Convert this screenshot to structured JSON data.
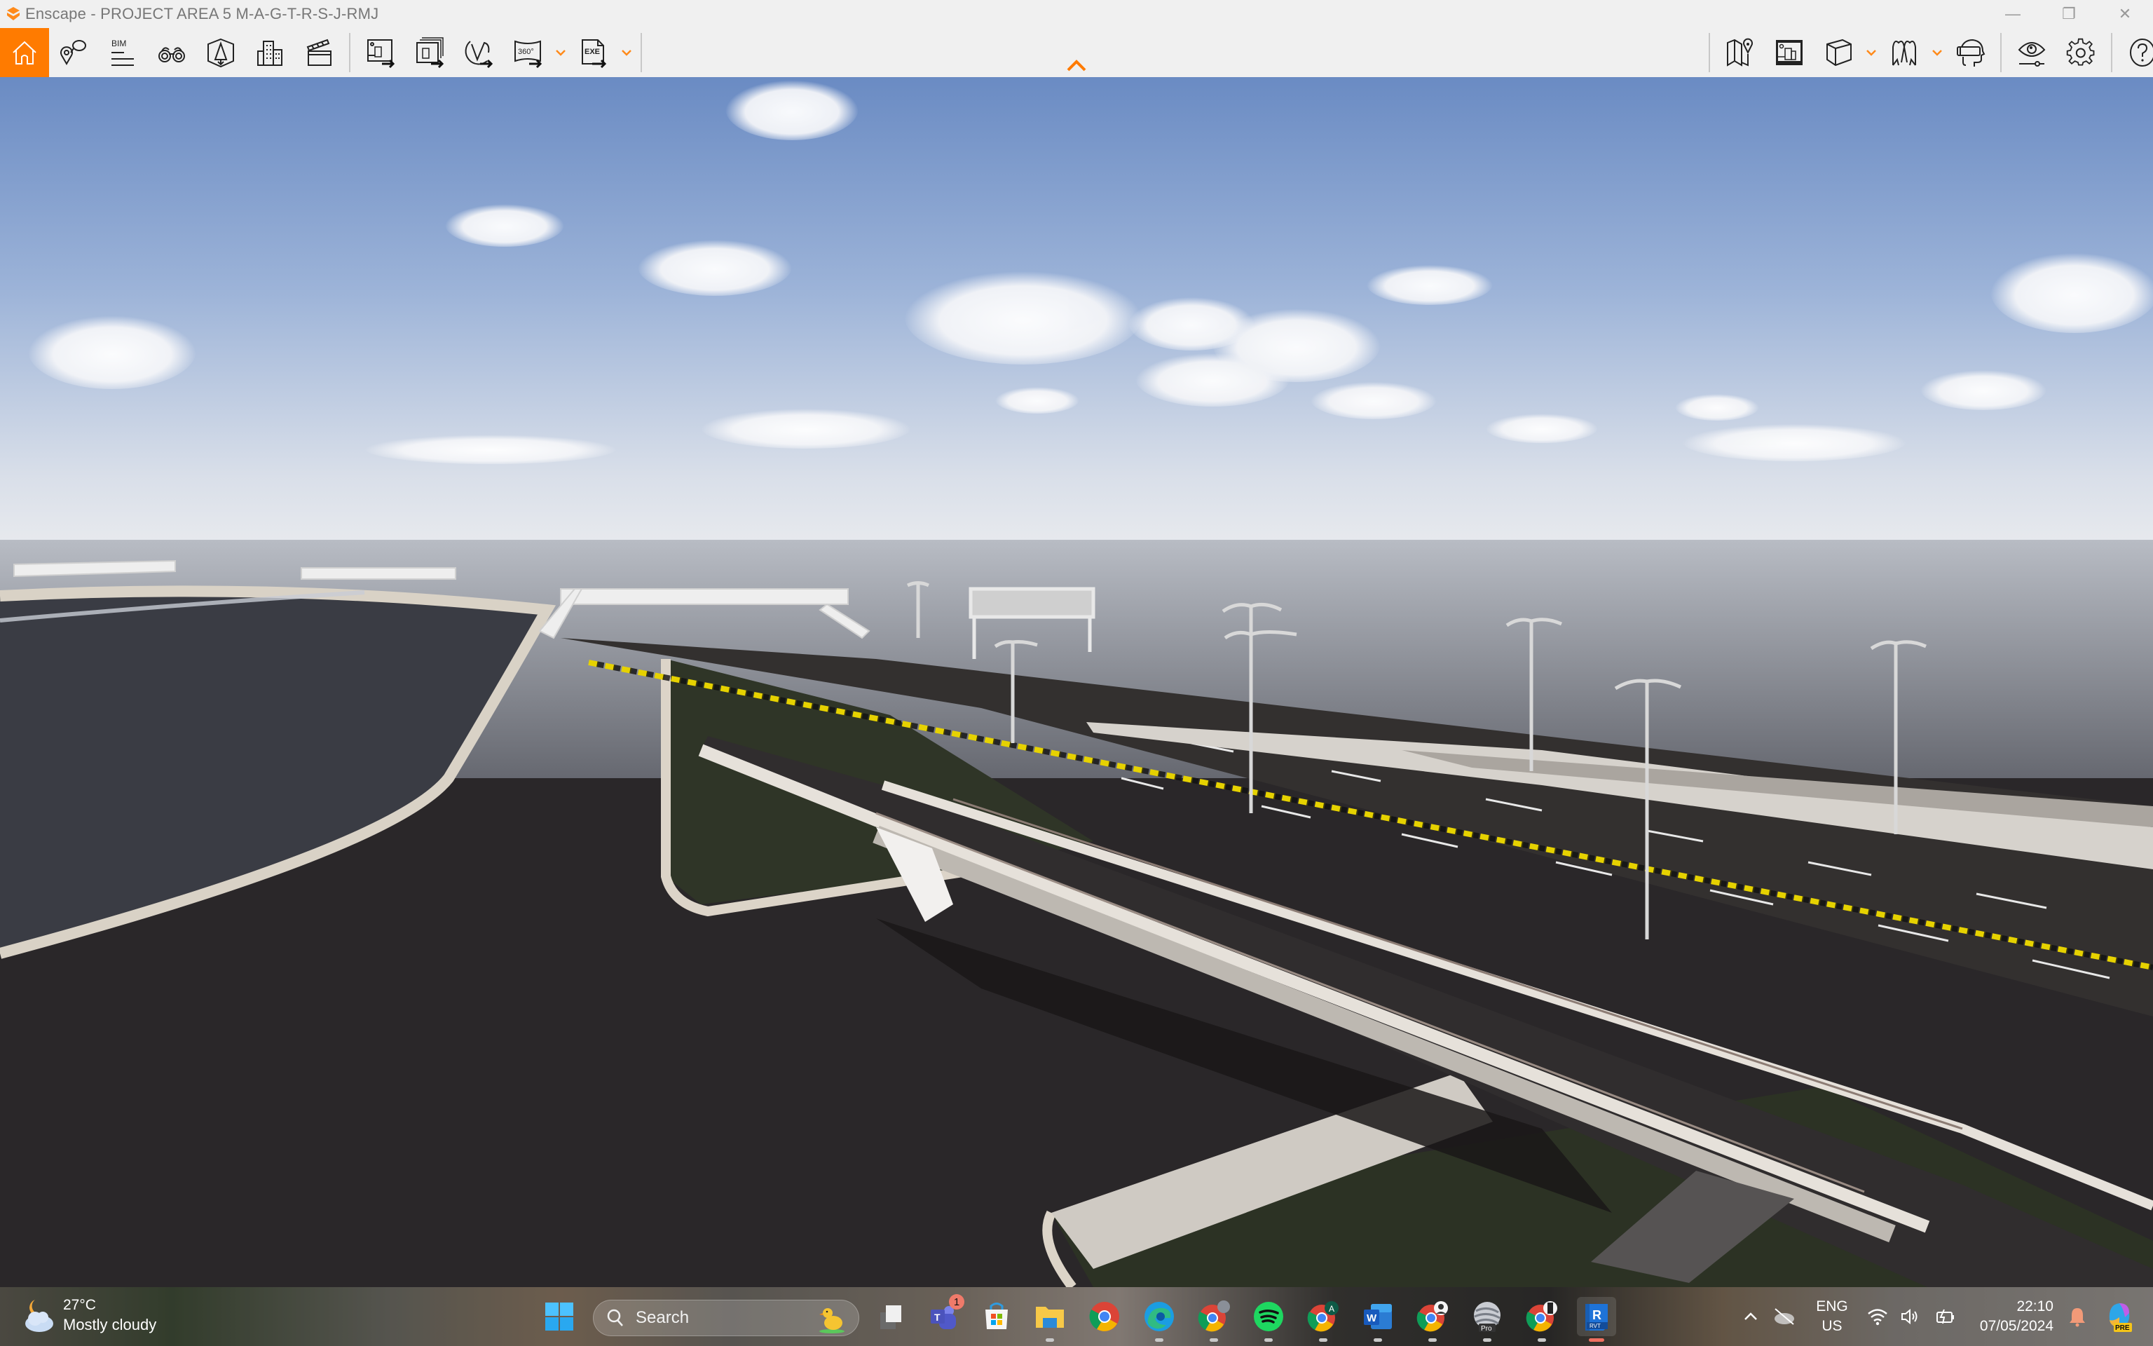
{
  "window": {
    "title": "Enscape - PROJECT AREA 5 M-A-G-T-R-S-J-RMJ",
    "accent_color": "#ff7b00",
    "controls": {
      "minimize": "—",
      "restore": "❐",
      "close": "✕"
    }
  },
  "toolbar": {
    "left_group": [
      {
        "id": "home",
        "icon": "home-icon",
        "active": true
      },
      {
        "id": "views",
        "icon": "map-pin-comment-icon"
      },
      {
        "id": "bim",
        "icon": "bim-info-icon",
        "label": "BIM"
      },
      {
        "id": "orbit",
        "icon": "binoculars-icon"
      },
      {
        "id": "assets",
        "icon": "asset-library-icon"
      },
      {
        "id": "sites",
        "icon": "buildings-icon"
      },
      {
        "id": "video",
        "icon": "clapperboard-icon"
      }
    ],
    "export_group": [
      {
        "id": "screenshot",
        "icon": "export-screenshot-icon"
      },
      {
        "id": "batch",
        "icon": "batch-render-icon"
      },
      {
        "id": "web",
        "icon": "web-standalone-icon"
      },
      {
        "id": "pano",
        "icon": "panorama-360-icon",
        "label": "360°",
        "has_dropdown": true
      },
      {
        "id": "exe",
        "icon": "export-exe-icon",
        "label": "EXE",
        "has_dropdown": true
      }
    ],
    "right_group": [
      {
        "id": "map",
        "icon": "map-location-icon"
      },
      {
        "id": "gallery",
        "icon": "gallery-icon"
      },
      {
        "id": "cube",
        "icon": "view-cube-icon",
        "has_dropdown": true
      },
      {
        "id": "vr",
        "icon": "vr-mode-icon",
        "has_dropdown": true
      },
      {
        "id": "headset",
        "icon": "vr-headset-icon"
      }
    ],
    "settings_group": [
      {
        "id": "visual",
        "icon": "visual-settings-icon"
      },
      {
        "id": "settings",
        "icon": "gear-icon"
      },
      {
        "id": "help",
        "icon": "help-icon"
      }
    ],
    "collapse_icon": "chevron-up-icon"
  },
  "scene": {
    "description": "3D rendered highway interchange with flyover bridge, pedestrian overpasses, street lights and overhead gantry sign",
    "sky_top": "#6f8fc4",
    "sky_bottom": "#e6e9ef",
    "ground": "#2a2728",
    "grass": "#2c3224",
    "median_yellow": "#e6d200"
  },
  "taskbar": {
    "weather": {
      "temperature": "27°C",
      "condition": "Mostly cloudy",
      "icon": "partly-cloudy-night-icon"
    },
    "search_placeholder": "Search",
    "apps": [
      {
        "name": "Task View",
        "icon": "task-view-icon"
      },
      {
        "name": "Microsoft Teams",
        "icon": "teams-icon",
        "badge": "1"
      },
      {
        "name": "Microsoft Store",
        "icon": "store-icon"
      },
      {
        "name": "File Explorer",
        "icon": "folder-icon",
        "running": true
      },
      {
        "name": "Google Chrome",
        "icon": "chrome-icon"
      },
      {
        "name": "Microsoft Edge",
        "icon": "edge-icon",
        "running": true
      },
      {
        "name": "Google Chrome (profile)",
        "icon": "chrome-icon",
        "running": true
      },
      {
        "name": "Spotify",
        "icon": "spotify-icon",
        "running": true
      },
      {
        "name": "Google Chrome (A)",
        "icon": "chrome-icon",
        "running": true
      },
      {
        "name": "Microsoft Word",
        "icon": "word-icon",
        "running": true
      },
      {
        "name": "Google Chrome (profile 2)",
        "icon": "chrome-icon",
        "running": true
      },
      {
        "name": "Google Earth Pro",
        "icon": "earth-pro-icon",
        "label": "Pro",
        "running": true
      },
      {
        "name": "Google Chrome (profile 3)",
        "icon": "chrome-icon",
        "running": true
      },
      {
        "name": "Revit",
        "icon": "revit-icon",
        "label": "R",
        "sublabel": "RVT",
        "running": true,
        "active": true
      }
    ],
    "tray": {
      "language": "ENG",
      "region": "US",
      "time": "22:10",
      "date": "07/05/2024",
      "copilot_badge": "PRE"
    }
  }
}
